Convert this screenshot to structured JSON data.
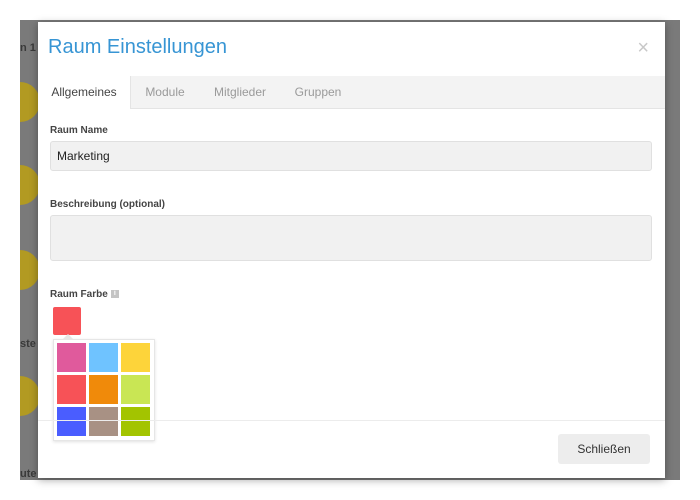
{
  "background": {
    "texts": [
      "n 1",
      "ste",
      "ute"
    ]
  },
  "modal": {
    "title": "Raum Einstellungen",
    "close_glyph": "×",
    "tabs": [
      {
        "label": "Allgemeines",
        "active": true
      },
      {
        "label": "Module",
        "active": false
      },
      {
        "label": "Mitglieder",
        "active": false
      },
      {
        "label": "Gruppen",
        "active": false
      }
    ],
    "fields": {
      "name_label": "Raum Name",
      "name_value": "Marketing",
      "description_label": "Beschreibung (optional)",
      "description_value": "",
      "color_label": "Raum Farbe",
      "info_icon_glyph": "i"
    },
    "color": {
      "selected": "#f75257",
      "palette": [
        "#e05a9c",
        "#6fc3ff",
        "#fdd43a",
        "#f75257",
        "#f08a0a",
        "#c9e654",
        "#4a5dff",
        "#a89184",
        "#a3c400"
      ]
    },
    "footer": {
      "close_label": "Schließen"
    }
  }
}
